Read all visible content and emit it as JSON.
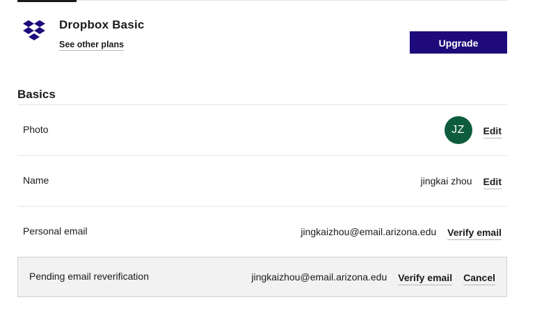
{
  "colors": {
    "accent": "#1e0a7a",
    "avatar_bg": "#0d5c3d",
    "panel_bg": "#f2f2f2",
    "logo": "#1e0a7a"
  },
  "icons": {
    "logo": "dropbox-logo-icon"
  },
  "plan": {
    "name": "Dropbox Basic",
    "other_plans_link": "See other plans",
    "upgrade_button": "Upgrade"
  },
  "basics": {
    "title": "Basics",
    "rows": [
      {
        "label": "Photo",
        "avatar_initials": "JZ",
        "action": "Edit"
      },
      {
        "label": "Name",
        "value": "jingkai zhou",
        "action": "Edit"
      },
      {
        "label": "Personal email",
        "value": "jingkaizhou@email.arizona.edu",
        "action": "Verify email"
      }
    ],
    "pending": {
      "label": "Pending email reverification",
      "value": "jingkaizhou@email.arizona.edu",
      "verify_action": "Verify email",
      "cancel_action": "Cancel"
    }
  }
}
